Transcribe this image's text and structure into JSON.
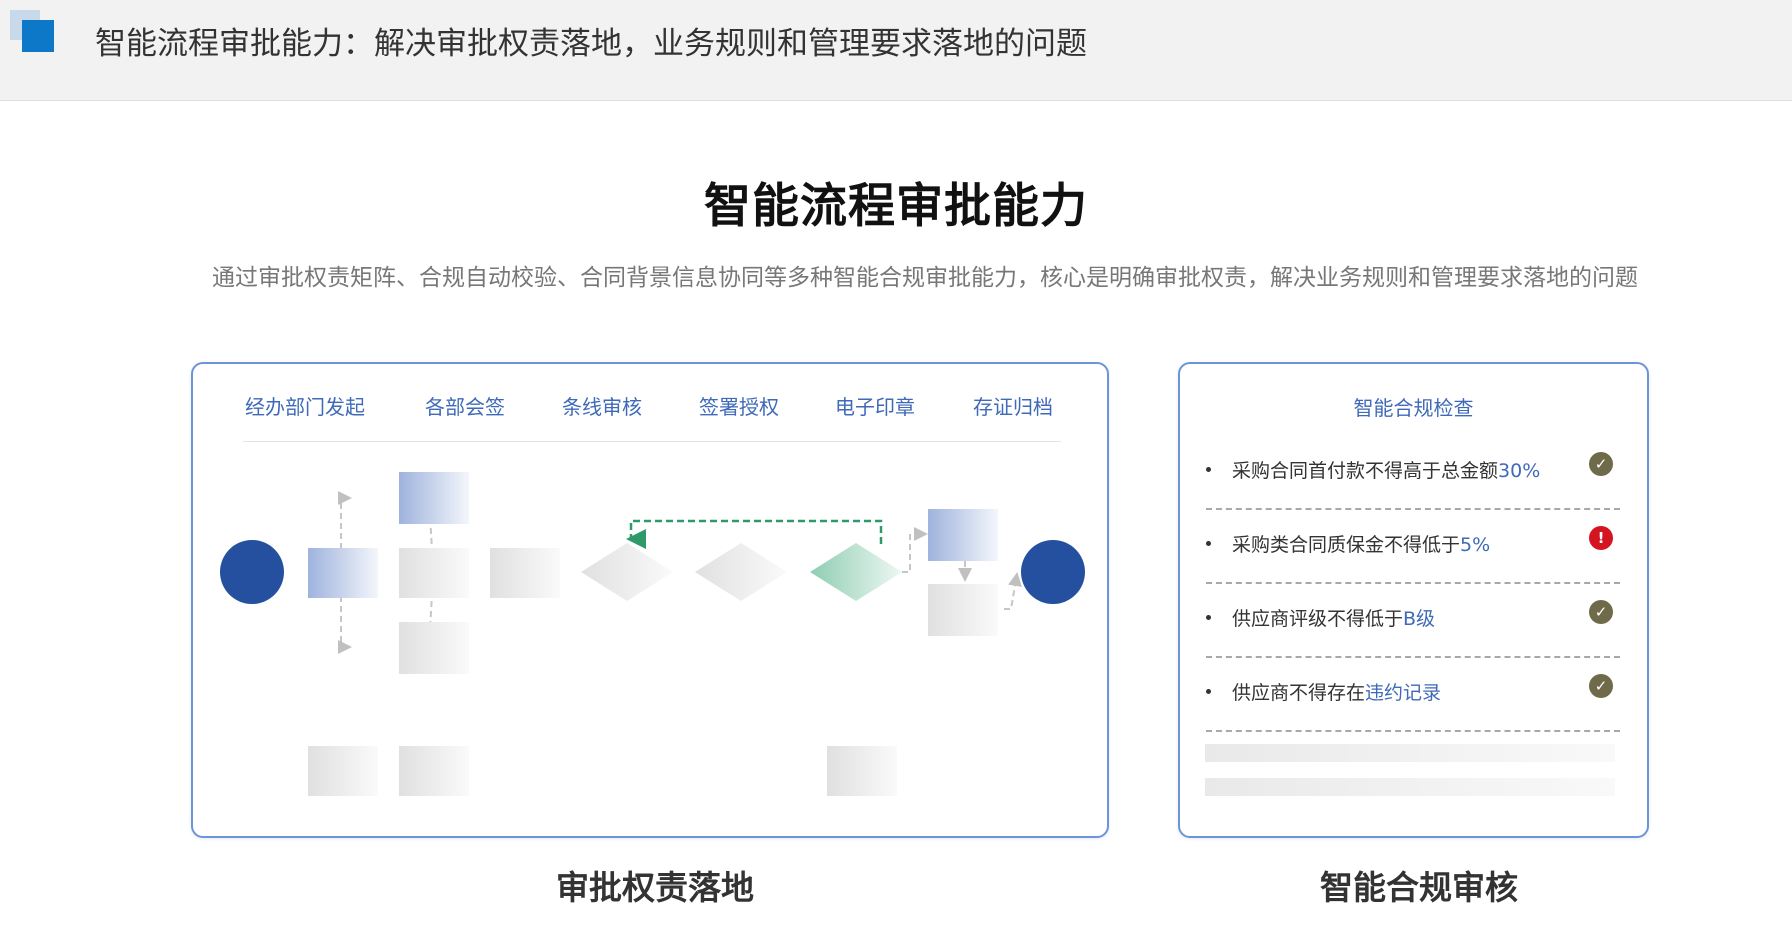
{
  "header": {
    "title": "智能流程审批能力：解决审批权责落地，业务规则和管理要求落地的问题"
  },
  "main": {
    "title": "智能流程审批能力",
    "subtitle": "通过审批权责矩阵、合规自动校验、合同背景信息协同等多种智能合规审批能力，核心是明确审批权责，解决业务规则和管理要求落地的问题"
  },
  "flow_card": {
    "steps": [
      "经办部门发起",
      "各部会签",
      "条线审核",
      "签署授权",
      "电子印章",
      "存证归档"
    ],
    "caption": "审批权责落地"
  },
  "compliance_card": {
    "title": "智能合规检查",
    "rules": [
      {
        "text": "采购合同首付款不得高于总金额",
        "highlight": "30%",
        "status": "pass"
      },
      {
        "text": "采购类合同质保金不得低于",
        "highlight": "5%",
        "status": "fail"
      },
      {
        "text": "供应商评级不得低于",
        "highlight": "B级",
        "status": "pass"
      },
      {
        "text": "供应商不得存在",
        "highlight": "违约记录",
        "status": "pass"
      }
    ],
    "caption": "智能合规审核"
  },
  "colors": {
    "accent": "#3f6ab8",
    "node_dark": "#24509f",
    "pass": "#6f6a4a",
    "fail": "#d41421",
    "logo": "#0d78c8"
  }
}
